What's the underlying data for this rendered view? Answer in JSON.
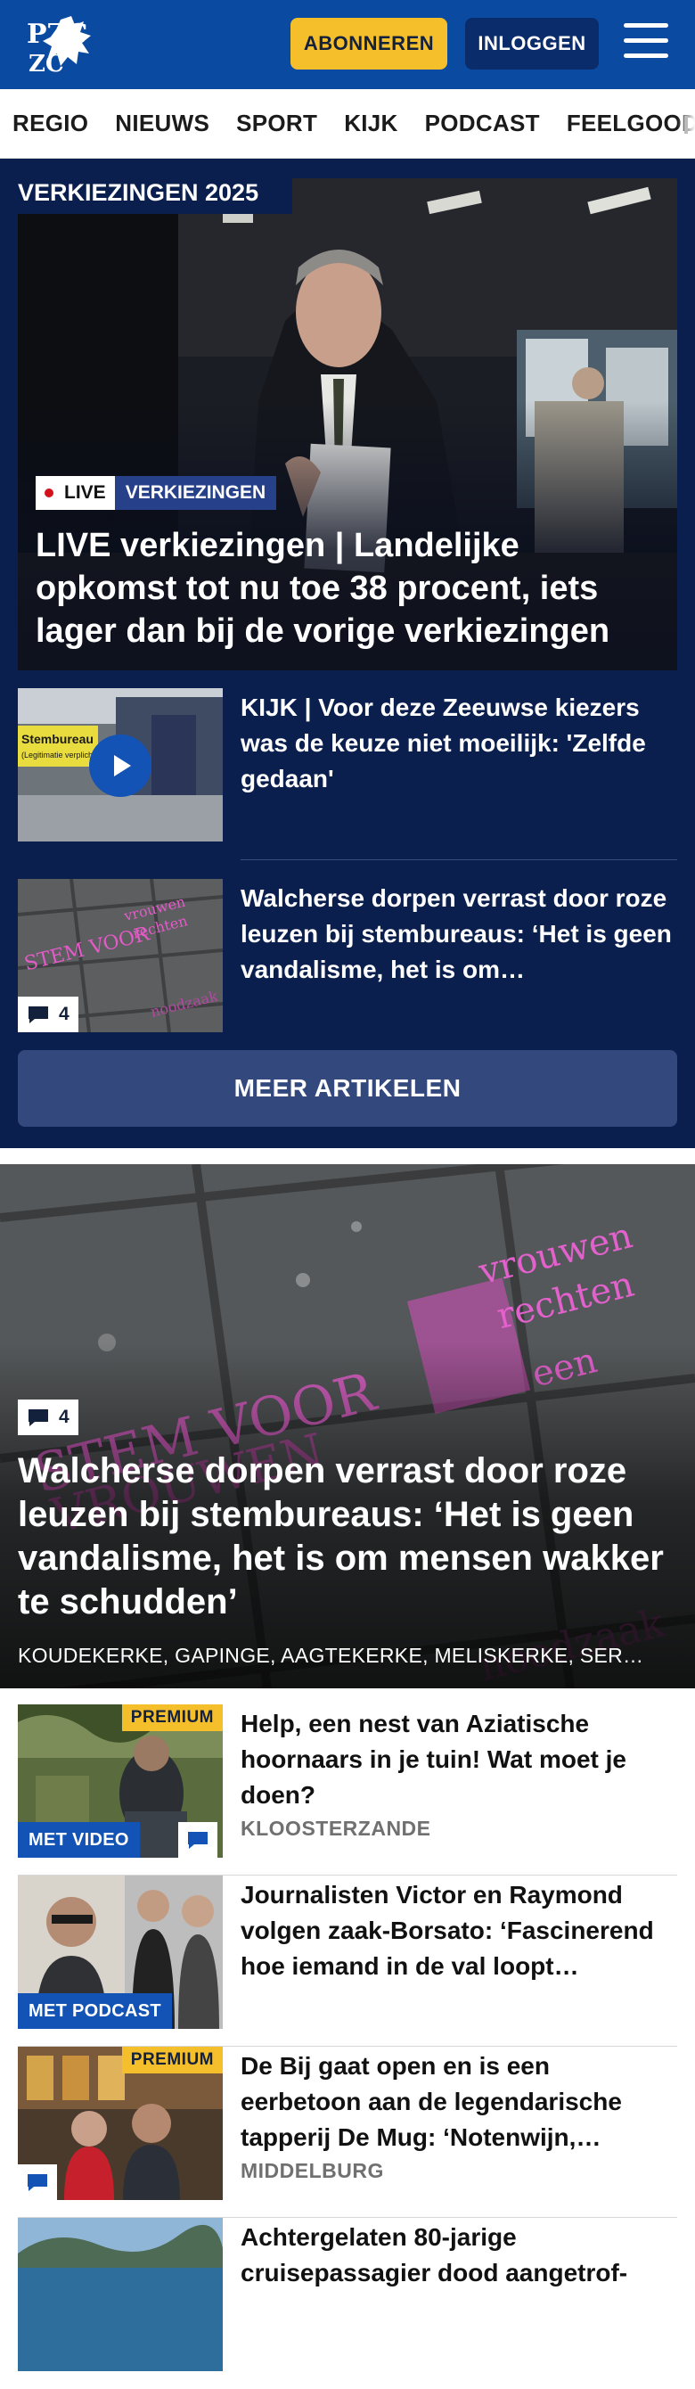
{
  "header": {
    "logo_text": "PZC",
    "subscribe_label": "ABONNEREN",
    "login_label": "INLOGGEN",
    "menu_icon": "hamburger-icon",
    "brand_color": "#0a4aa0",
    "accent_color": "#f5bf2c"
  },
  "nav": {
    "items": [
      "REGIO",
      "NIEUWS",
      "SPORT",
      "KIJK",
      "PODCAST",
      "FEELGOOD"
    ]
  },
  "elections": {
    "section_label": "VERKIEZINGEN 2025",
    "hero": {
      "live_label": "LIVE",
      "category_label": "VERKIEZINGEN",
      "title": "LIVE verkiezingen | Landelijke opkomst tot nu toe 38 procent, iets lager dan bij de vorige verkiezingen"
    },
    "items": [
      {
        "title": "KIJK | Voor deze Zeeuwse kiezers was de keuze niet moeilijk: 'Zelfde gedaan'",
        "icon": "play-icon",
        "thumb_sign_line1": "Stembureau",
        "thumb_sign_line2": "(Legitimatie verplicht)"
      },
      {
        "title": "Walcherse dorpen verrast door roze leuzen bij stembureaus: ‘Het is geen vandalisme, het is om…",
        "comment_count": "4",
        "icon": "comment-icon"
      }
    ],
    "more_label": "MEER ARTIKELEN",
    "background_color": "#0b1f4f"
  },
  "big_article": {
    "comment_count": "4",
    "title": "Walcherse dorpen verrast door roze leuzen bij stembureaus: ‘Het is geen vandalisme, het is om mensen wakker te schudden’",
    "places": "KOUDEKERKE, GAPINGE, AAGTEKERKE, MELISKERKE, SER…"
  },
  "list": [
    {
      "title": "Help, een nest van Aziatische hoornaars in je tuin! Wat moet je doen?",
      "location": "KLOOSTERZANDE",
      "premium": "PREMIUM",
      "media_label": "MET VIDEO",
      "has_comment": true
    },
    {
      "title": "Journalisten Victor en Raymond volgen zaak-Borsato: ‘Fascine­rend hoe iemand in de val loopt…",
      "location": "",
      "premium": "",
      "media_label": "MET PODCAST",
      "has_comment": false
    },
    {
      "title": "De Bij gaat open en is een eerbetoon aan de legendarische tapperij De Mug: ‘Notenwijn,…",
      "location": "MIDDELBURG",
      "premium": "PREMIUM",
      "media_label": "",
      "has_comment": true
    },
    {
      "title": "Achtergelaten 80-jarige cruisepassagier dood aangetrof-",
      "location": "",
      "premium": "",
      "media_label": "",
      "has_comment": false
    }
  ]
}
